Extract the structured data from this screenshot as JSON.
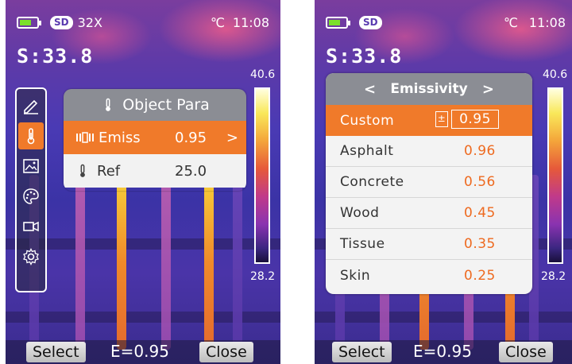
{
  "left": {
    "status": {
      "storage": "SD",
      "zoom": "32X",
      "unit": "℃",
      "time": "11:08"
    },
    "spot": "S:33.8",
    "scale": {
      "max": "40.6",
      "min": "28.2"
    },
    "menu_icons": [
      "edit-icon",
      "thermometer-icon",
      "image-icon",
      "palette-icon",
      "video-icon",
      "settings-icon"
    ],
    "panel": {
      "title": "Object Para",
      "rows": [
        {
          "label": "Emiss",
          "value": "0.95"
        },
        {
          "label": "Ref",
          "value": "25.0"
        }
      ]
    },
    "bottom": {
      "select": "Select",
      "emissivity": "E=0.95",
      "close": "Close"
    }
  },
  "right": {
    "status": {
      "storage": "SD",
      "unit": "℃",
      "time": "11:08"
    },
    "spot": "S:33.8",
    "scale": {
      "max": "40.6",
      "min": "28.2"
    },
    "dialog": {
      "title": "Emissivity",
      "prev": "<",
      "next": ">",
      "custom_label": "Custom",
      "custom_sign": "±",
      "custom_value": "0.95",
      "items": [
        {
          "name": "Asphalt",
          "value": "0.96"
        },
        {
          "name": "Concrete",
          "value": "0.56"
        },
        {
          "name": "Wood",
          "value": "0.45"
        },
        {
          "name": "Tissue",
          "value": "0.35"
        },
        {
          "name": "Skin",
          "value": "0.25"
        }
      ]
    },
    "bottom": {
      "select": "Select",
      "emissivity": "E=0.95",
      "close": "Close"
    }
  },
  "colors": {
    "accent": "#f07a2a",
    "header": "#8b8d94",
    "value_text": "#ee6a20"
  }
}
